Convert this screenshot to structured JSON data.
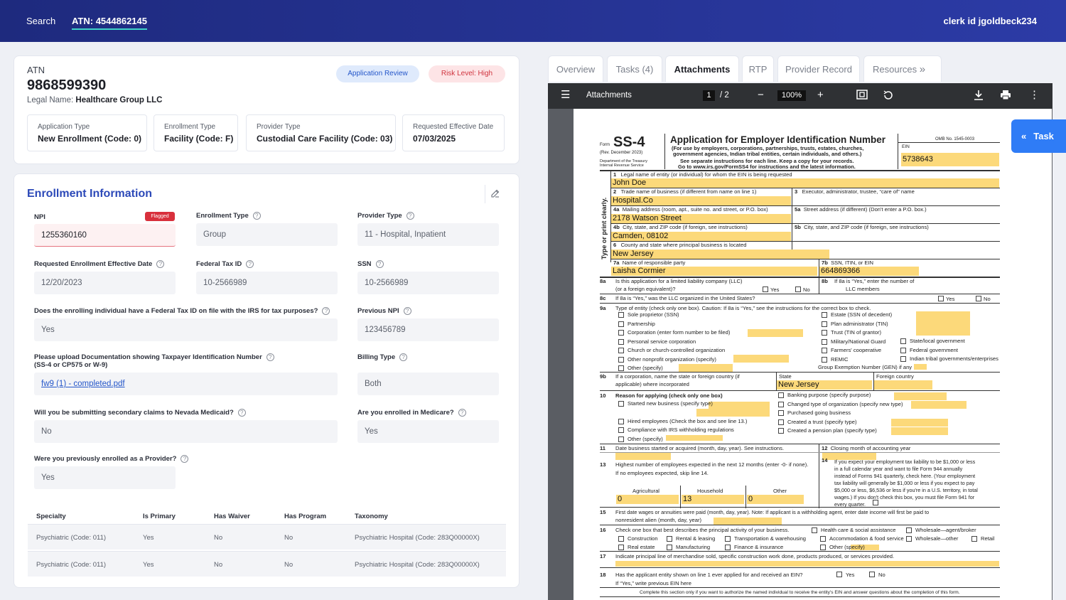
{
  "topbar": {
    "search": "Search",
    "atn": "ATN: 4544862145",
    "clerk": "clerk id jgoldbeck234"
  },
  "summary": {
    "atn_label": "ATN",
    "atn_value": "9868599390",
    "legal_label": "Legal Name:",
    "legal_value": "Healthcare Group LLC",
    "status_badge": "Application Review",
    "risk_badge": "Risk Level: High",
    "boxes": [
      {
        "k": "Application Type",
        "v": "New Enrollment (Code: 0)"
      },
      {
        "k": "Enrollment Type",
        "v": "Facility (Code: F)"
      },
      {
        "k": "Provider Type",
        "v": "Custodial Care Facility (Code: 03)"
      },
      {
        "k": "Requested Effective Date",
        "v": "07/03/2025"
      }
    ]
  },
  "enrollment": {
    "title": "Enrollment Information",
    "npi_label": "NPI",
    "npi_flag": "Flagged",
    "npi_value": "1255360160",
    "enroll_type_label": "Enrollment Type",
    "enroll_type_value": "Group",
    "provider_type_label": "Provider Type",
    "provider_type_value": "11 - Hospital, Inpatient",
    "req_date_label": "Requested Enrollment Effective Date",
    "req_date_value": "12/20/2023",
    "fed_tax_label": "Federal Tax ID",
    "fed_tax_value": "10-2566989",
    "ssn_label": "SSN",
    "ssn_value": "10-2566989",
    "q_fedtax_label": "Does the enrolling individual have a Federal Tax ID on file with the IRS for tax purposes?",
    "q_fedtax_value": "Yes",
    "prev_npi_label": "Previous NPI",
    "prev_npi_value": "123456789",
    "upload_label_1": "Please upload Documentation showing Taxpayer Identification Number",
    "upload_label_2": "(SS-4 or CP575 or W-9)",
    "upload_file": "fw9 (1) - completed.pdf",
    "billing_label": "Billing Type",
    "billing_value": "Both",
    "secondary_label": "Will you be submitting secondary claims to Nevada Medicaid?",
    "secondary_value": "No",
    "medicare_label": "Are you enrolled in Medicare?",
    "medicare_value": "Yes",
    "prev_enrolled_label": "Were you previously enrolled as a Provider?",
    "prev_enrolled_value": "Yes",
    "table": {
      "headers": [
        "Specialty",
        "Is Primary",
        "Has Waiver",
        "Has Program",
        "Taxonomy"
      ],
      "rows": [
        [
          "Psychiatric (Code: 011)",
          "Yes",
          "No",
          "No",
          "Psychiatric Hospital (Code: 283Q00000X)"
        ],
        [
          "Psychiatric (Code: 011)",
          "Yes",
          "No",
          "No",
          "Psychiatric Hospital (Code: 283Q00000X)"
        ]
      ]
    }
  },
  "tabs": [
    "Overview",
    "Tasks (4)",
    "Attachments",
    "RTP",
    "Provider Record",
    "Resources"
  ],
  "viewer": {
    "title": "Attachments",
    "page": "1",
    "page_total": "/ 2",
    "zoom": "100%"
  },
  "task_button": "Task",
  "form": {
    "form_word": "Form",
    "form_no": "SS-4",
    "rev": "(Rev. December 2023)",
    "dept1": "Department of the Treasury",
    "dept2": "Internal Revenue Service",
    "title": "Application for Employer Identification Number",
    "sub1": "(For use by employers, corporations, partnerships, trusts, estates, churches,",
    "sub2": "government agencies, Indian tribal entities, certain individuals, and others.)",
    "sub3": "See separate instructions for each line. Keep a copy for your records.",
    "sub4": "Go to www.irs.gov/FormSS4 for instructions and the latest information.",
    "omb": "OMB No. 1545-0003",
    "ein_label": "EIN",
    "ein": "5738643",
    "side": "Type or print clearly.",
    "l1": "Legal name of entity (or individual) for whom the EIN is being requested",
    "v1": "John Doe",
    "l2": "Trade name of business (if different from name on line 1)",
    "v2": "Hospital.Co",
    "l3": "Executor, administrator, trustee, “care of” name",
    "l4a": "Mailing address (room, apt., suite no. and street, or P.O. box)",
    "v4a": "2178 Watson Street",
    "l5a": "Street address (if different) (Don't enter a P.O. box.)",
    "l4b": "City, state, and ZIP code (if foreign, see instructions)",
    "v4b": "Camden, 08102",
    "l5b": "City, state, and ZIP code (if foreign, see instructions)",
    "l6": "County and state where principal business is located",
    "v6": "New Jersey",
    "l7a": "Name of responsible party",
    "v7a": "Laisha Cormier",
    "l7b": "SSN, ITIN, or EIN",
    "v7b": "664869366",
    "l8a1": "Is this application for a limited liability company (LLC)",
    "l8a2": "(or a foreign equivalent)?",
    "yes": "Yes",
    "no": "No",
    "l8b1": "If 8a is “Yes,” enter the number of",
    "l8b2": "LLC members",
    "l8c": "If 8a is “Yes,” was the LLC organized in the United States?",
    "l9a": "Type of entity (check only one box). Caution: If 8a is “Yes,” see the instructions for the correct box to check.",
    "e_left": [
      "Sole proprietor (SSN)",
      "Partnership",
      "Corporation (enter form number to be filed)",
      "Personal service corporation",
      "Church or church-controlled organization",
      "Other nonprofit organization (specify)",
      "Other (specify)"
    ],
    "e_mid": [
      "Estate (SSN of decedent)",
      "Plan administrator (TIN)",
      "Trust (TIN of grantor)",
      "Military/National Guard",
      "Farmers' cooperative",
      "REMIC"
    ],
    "e_right": [
      "State/local government",
      "Federal government",
      "Indian tribal governments/enterprises"
    ],
    "gen": "Group Exemption Number (GEN) if any",
    "l9b1": "If a corporation, name the state or foreign country (if",
    "l9b2": "applicable) where incorporated",
    "state_label": "State",
    "state": "New Jersey",
    "foreign": "Foreign country",
    "l10": "Reason for applying (check only one box)",
    "r_left": [
      "Started new business (specify type)",
      "Hired employees (Check the box and see line 13.)",
      "Compliance with IRS withholding regulations",
      "Other (specify)"
    ],
    "r_right": [
      "Banking purpose (specify purpose)",
      "Changed type of organization (specify new type)",
      "Purchased going business",
      "Created a trust (specify type)",
      "Created a pension plan (specify type)"
    ],
    "l11": "Date business started or acquired (month, day, year). See instructions.",
    "l12": "Closing month of accounting year",
    "l13a": "Highest number of employees expected in the next 12 months (enter -0- if none).",
    "l13b": "If no employees expected, skip line 14.",
    "l14": [
      "If you expect your employment tax liability to be $1,000 or less",
      "in a full calendar year and want to file Form 944 annually",
      "instead of Forms 941 quarterly, check here. (Your employment",
      "tax liability will generally be $1,000 or less if you expect to pay",
      "$5,000 or less, $6,536 or less if you're in a U.S. territory, in total",
      "wages.) If you don't check this box, you must file Form 941 for",
      "every quarter."
    ],
    "agri": "Agricultural",
    "household": "Household",
    "other": "Other",
    "v_agri": "0",
    "v_house": "13",
    "v_other": "0",
    "l15a": "First date wages or annuities were paid (month, day, year). Note: If applicant is a withholding agent, enter date income will first be paid to",
    "l15b": "nonresident alien (month, day, year)",
    "l16": "Check one box that best describes the principal activity of your business.",
    "a16": [
      "Construction",
      "Rental & leasing",
      "Transportation & warehousing",
      "Real estate",
      "Manufacturing",
      "Finance & insurance",
      "Health care & social assistance",
      "Accommodation & food service",
      "Other (specify)",
      "Wholesale—agent/broker",
      "Wholesale—other",
      "Retail"
    ],
    "l17": "Indicate principal line of merchandise sold, specific construction work done, products produced, or services provided.",
    "l18a": "Has the applicant entity shown on line 1 ever applied for and received an EIN?",
    "l18b": "If “Yes,” write previous EIN here",
    "l19": "Complete this section only if you want to authorize the named individual to receive the entity's EIN and answer questions about the completion of this form."
  }
}
